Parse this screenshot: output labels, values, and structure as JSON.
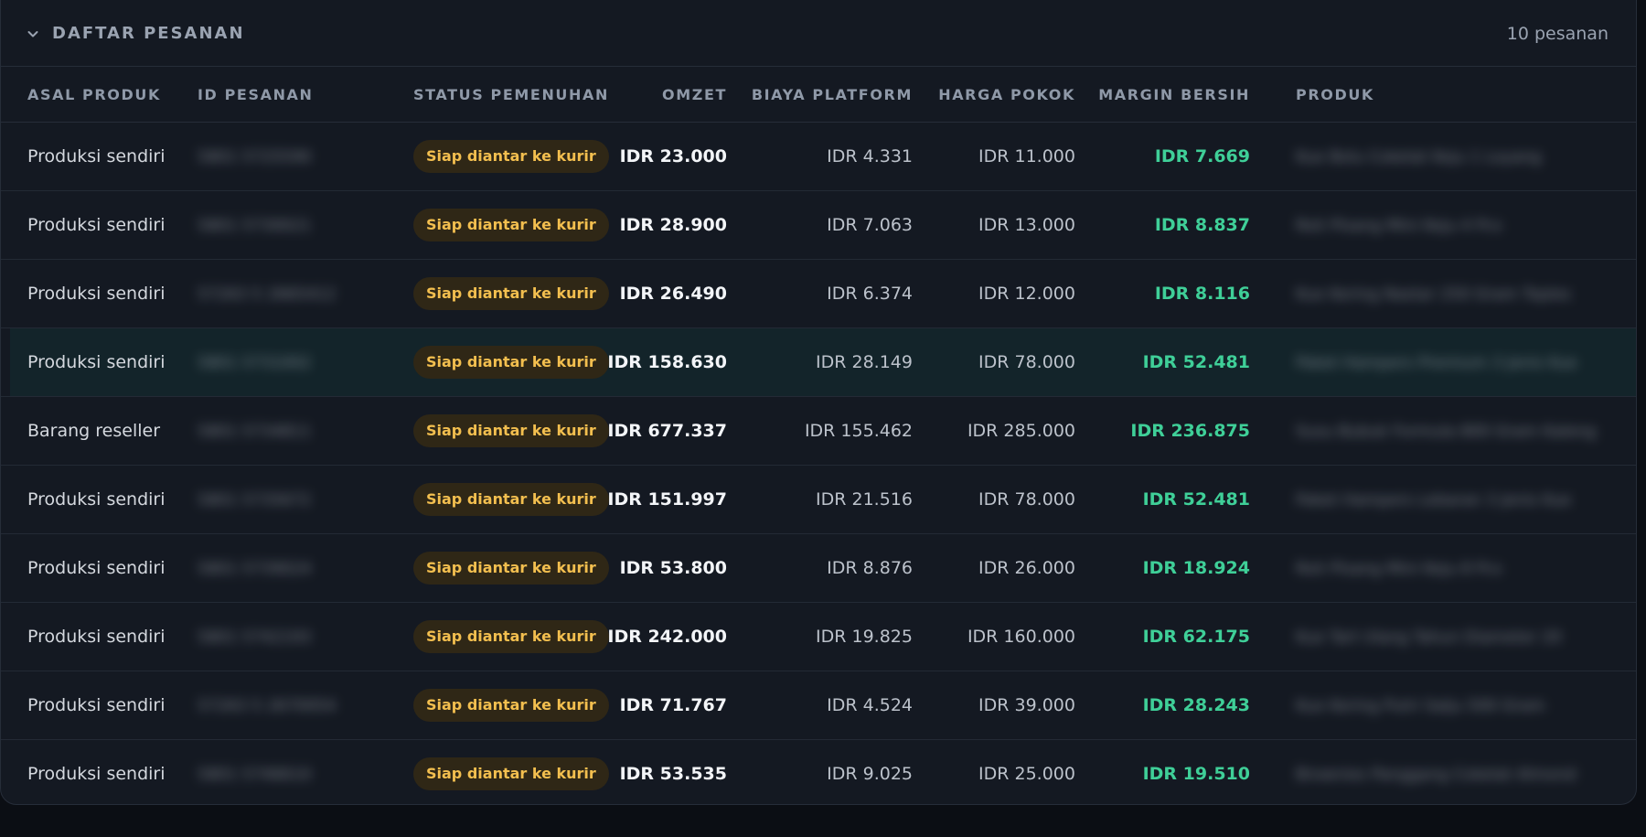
{
  "header": {
    "title": "DAFTAR PESANAN",
    "count_label": "10 pesanan"
  },
  "columns": {
    "origin": "ASAL PRODUK",
    "order_id": "ID PESANAN",
    "status": "STATUS PEMENUHAN",
    "revenue": "OMZET",
    "platform_fee": "BIAYA PLATFORM",
    "cost": "HARGA POKOK",
    "margin": "MARGIN BERSIH",
    "product": "PRODUK"
  },
  "rows": [
    {
      "origin": "Produksi sendiri",
      "order_id": "5801 5725590",
      "status": "Siap diantar ke kurir",
      "revenue": "IDR 23.000",
      "platform_fee": "IDR 4.331",
      "cost": "IDR 11.000",
      "margin": "IDR 7.669",
      "product": "Kue Bolu Cokelat Keju 1 Loyang"
    },
    {
      "origin": "Produksi sendiri",
      "order_id": "5801 5730021",
      "status": "Siap diantar ke kurir",
      "revenue": "IDR 28.900",
      "platform_fee": "IDR 7.063",
      "cost": "IDR 13.000",
      "margin": "IDR 8.837",
      "product": "Roti Pisang Mini Keju 4 Pcs"
    },
    {
      "origin": "Produksi sendiri",
      "order_id": "57263 5 2665412",
      "status": "Siap diantar ke kurir",
      "revenue": "IDR 26.490",
      "platform_fee": "IDR 6.374",
      "cost": "IDR 12.000",
      "margin": "IDR 8.116",
      "product": "Kue Kering Nastar 250 Gram Toples"
    },
    {
      "origin": "Produksi sendiri",
      "order_id": "5801 5731002",
      "status": "Siap diantar ke kurir",
      "revenue": "IDR 158.630",
      "platform_fee": "IDR 28.149",
      "cost": "IDR 78.000",
      "margin": "IDR 52.481",
      "product": "Paket Hampers Premium 3 Jenis Kue"
    },
    {
      "origin": "Barang reseller",
      "order_id": "5801 5734811",
      "status": "Siap diantar ke kurir",
      "revenue": "IDR 677.337",
      "platform_fee": "IDR 155.462",
      "cost": "IDR 285.000",
      "margin": "IDR 236.875",
      "product": "Susu Bubuk Formula 800 Gram Kaleng"
    },
    {
      "origin": "Produksi sendiri",
      "order_id": "5801 5735672",
      "status": "Siap diantar ke kurir",
      "revenue": "IDR 151.997",
      "platform_fee": "IDR 21.516",
      "cost": "IDR 78.000",
      "margin": "IDR 52.481",
      "product": "Paket Hampers Lebaran 3 Jenis Kue"
    },
    {
      "origin": "Produksi sendiri",
      "order_id": "5801 5739024",
      "status": "Siap diantar ke kurir",
      "revenue": "IDR 53.800",
      "platform_fee": "IDR 8.876",
      "cost": "IDR 26.000",
      "margin": "IDR 18.924",
      "product": "Roti Pisang Mini Keju 8 Pcs"
    },
    {
      "origin": "Produksi sendiri",
      "order_id": "5801 5742193",
      "status": "Siap diantar ke kurir",
      "revenue": "IDR 242.000",
      "platform_fee": "IDR 19.825",
      "cost": "IDR 160.000",
      "margin": "IDR 62.175",
      "product": "Kue Tart Ulang Tahun Diameter 20"
    },
    {
      "origin": "Produksi sendiri",
      "order_id": "57263 5 2670054",
      "status": "Siap diantar ke kurir",
      "revenue": "IDR 71.767",
      "platform_fee": "IDR 4.524",
      "cost": "IDR 39.000",
      "margin": "IDR 28.243",
      "product": "Kue Kering Putri Salju 500 Gram"
    },
    {
      "origin": "Produksi sendiri",
      "order_id": "5801 5746610",
      "status": "Siap diantar ke kurir",
      "revenue": "IDR 53.535",
      "platform_fee": "IDR 9.025",
      "cost": "IDR 25.000",
      "margin": "IDR 19.510",
      "product": "Brownies Panggang Cokelat Almond"
    }
  ],
  "highlighted_row": 3,
  "colors": {
    "badge_bg": "#2f2716",
    "badge_text": "#f3bf4f",
    "margin_text": "#3fcf98",
    "panel_bg": "#141922"
  },
  "icons": {
    "collapse": "chevron-down-icon"
  }
}
